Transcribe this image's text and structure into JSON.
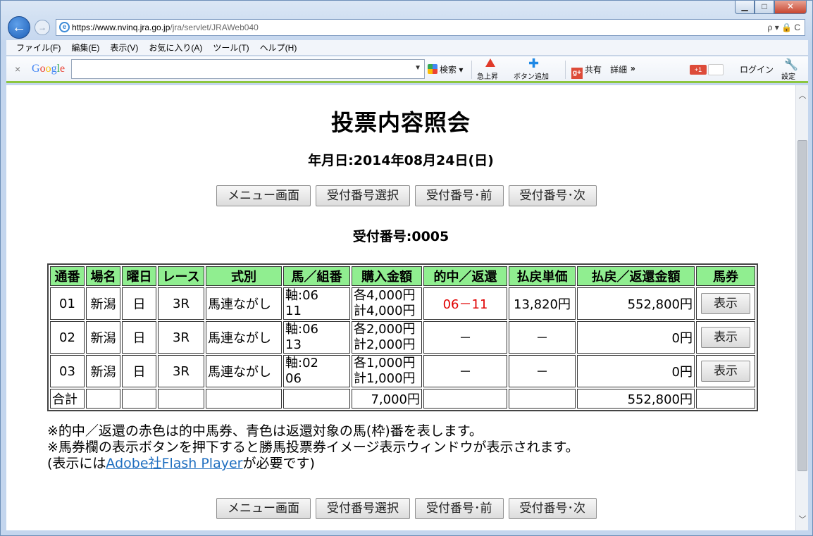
{
  "browser": {
    "url_host": "https://www.nvinq.jra.go.jp",
    "url_rest": "/jra/servlet/JRAWeb040",
    "address_tools": "ρ ▾ 🔒 C",
    "window_buttons": {
      "minimize": "▁",
      "maximize": "□",
      "close": "✕"
    },
    "menu": [
      "ファイル(F)",
      "編集(E)",
      "表示(V)",
      "お気に入り(A)",
      "ツール(T)",
      "ヘルプ(H)"
    ],
    "google_toolbar": {
      "close": "×",
      "logo": "Google",
      "search_label": "検索",
      "rise_label": "急上昇",
      "add_button_label": "ボタン追加",
      "share_label": "共有",
      "detail_label": "詳細",
      "more": "»",
      "gplus_badge": "+1",
      "login_label": "ログイン",
      "settings_label": "設定"
    }
  },
  "page": {
    "title": "投票内容照会",
    "date_line": "年月日:2014年08月24日(日)",
    "buttons": [
      "メニュー画面",
      "受付番号選択",
      "受付番号･前",
      "受付番号･次"
    ],
    "receipt_line": "受付番号:0005"
  },
  "table": {
    "headers": [
      "通番",
      "場名",
      "曜日",
      "レース",
      "式別",
      "馬／組番",
      "購入金額",
      "的中／返還",
      "払戻単価",
      "払戻／返還金額",
      "馬券"
    ],
    "rows": [
      {
        "no": "01",
        "venue": "新潟",
        "day": "日",
        "race": "3R",
        "type": "馬連ながし",
        "combo1": "軸:06",
        "combo2": "11",
        "amount1": "各4,000円",
        "amount2": "計4,000円",
        "hit": "06－11",
        "unit": "13,820円",
        "payout": "552,800円",
        "ticket": "表示"
      },
      {
        "no": "02",
        "venue": "新潟",
        "day": "日",
        "race": "3R",
        "type": "馬連ながし",
        "combo1": "軸:06",
        "combo2": "13",
        "amount1": "各2,000円",
        "amount2": "計2,000円",
        "hit": "－",
        "unit": "－",
        "payout": "0円",
        "ticket": "表示"
      },
      {
        "no": "03",
        "venue": "新潟",
        "day": "日",
        "race": "3R",
        "type": "馬連ながし",
        "combo1": "軸:02",
        "combo2": "06",
        "amount1": "各1,000円",
        "amount2": "計1,000円",
        "hit": "－",
        "unit": "－",
        "payout": "0円",
        "ticket": "表示"
      }
    ],
    "total": {
      "label": "合計",
      "amount": "7,000円",
      "payout": "552,800円"
    }
  },
  "notes": {
    "line1": "※的中／返還の赤色は的中馬券、青色は返還対象の馬(枠)番を表します。",
    "line2": "※馬券欄の表示ボタンを押下すると勝馬投票券イメージ表示ウィンドウが表示されます。",
    "line3_pre": "(表示には",
    "line3_link": "Adobe社Flash Player",
    "line3_post": "が必要です)"
  },
  "colors": {
    "header_bg": "#90ee90",
    "hit_text": "#e00000",
    "link": "#1f6fc0",
    "toolbar_accent": "#8cc63f"
  }
}
